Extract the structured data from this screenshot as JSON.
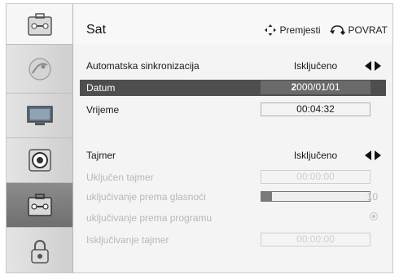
{
  "header": {
    "title": "Sat",
    "move_label": "Premjesti",
    "back_label": "POVRAT"
  },
  "sidebar": {
    "items": [
      {
        "icon": "settings-toolbox-icon",
        "selected": false
      },
      {
        "icon": "satellite-dish-icon",
        "selected": false
      },
      {
        "icon": "tv-screen-icon",
        "selected": false
      },
      {
        "icon": "speaker-icon",
        "selected": false
      },
      {
        "icon": "toolbox-icon",
        "selected": true
      },
      {
        "icon": "lock-icon",
        "selected": false
      }
    ]
  },
  "settings": {
    "auto_sync": {
      "label": "Automatska sinkronizacija",
      "value": "Isključeno"
    },
    "date": {
      "label": "Datum",
      "value_cursor": "2",
      "value_rest": "000/01/01"
    },
    "time": {
      "label": "Vrijeme",
      "value": "00:04:32"
    },
    "timer": {
      "label": "Tajmer",
      "value": "Isključeno"
    },
    "timer_on": {
      "label": "Uključen tajmer",
      "value": "00:00:00"
    },
    "on_volume": {
      "label": "uključivanje prema glasnoći",
      "value": "10",
      "level": 10
    },
    "on_program": {
      "label": "uključivanje prema programu"
    },
    "timer_off": {
      "label": "Isključivanje tajmer",
      "value": "00:00:00"
    }
  },
  "colors": {
    "selected_row": "#4e4e4e",
    "disabled_text": "#b8b8b8"
  }
}
